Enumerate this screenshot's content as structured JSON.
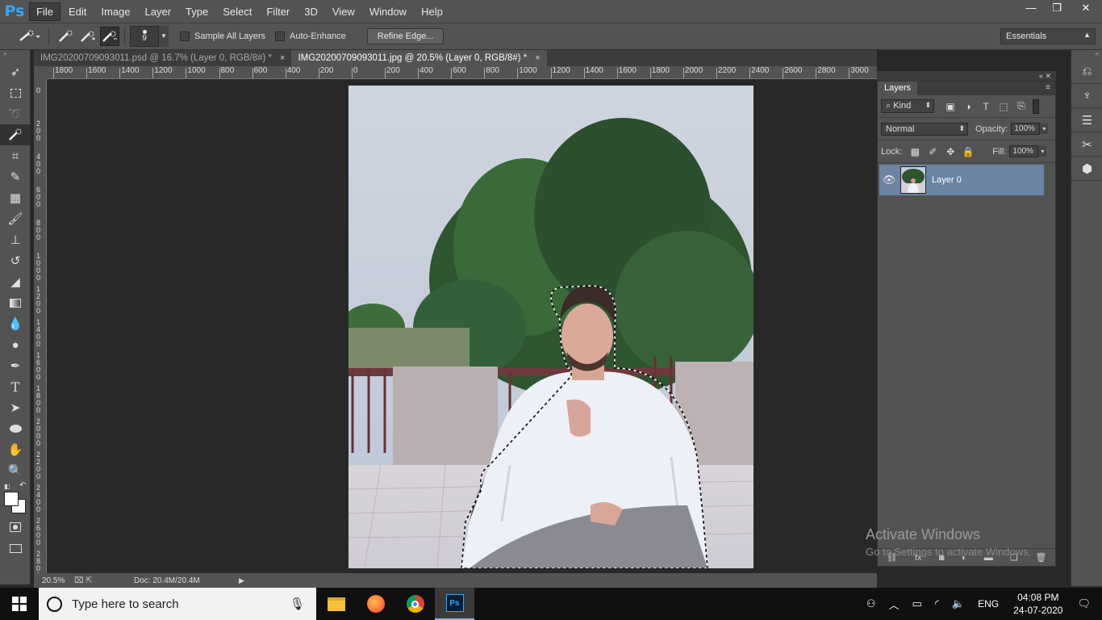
{
  "app": {
    "logo": "Ps"
  },
  "menu": [
    "File",
    "Edit",
    "Image",
    "Layer",
    "Type",
    "Select",
    "Filter",
    "3D",
    "View",
    "Window",
    "Help"
  ],
  "window_controls": {
    "minimize": "—",
    "restore": "❐",
    "close": "✕"
  },
  "options": {
    "brush_size": "9",
    "sample_all_layers": "Sample All Layers",
    "auto_enhance": "Auto-Enhance",
    "refine_edge": "Refine Edge...",
    "workspace": "Essentials"
  },
  "tabs": [
    {
      "label": "IMG20200709093011.psd @ 16.7% (Layer 0, RGB/8#) *",
      "close": "×"
    },
    {
      "label": "IMG20200709093011.jpg @ 20.5% (Layer 0, RGB/8#) *",
      "close": "×"
    }
  ],
  "ruler": {
    "h_ticks": [
      "1800",
      "1600",
      "1400",
      "1200",
      "1000",
      "800",
      "600",
      "400",
      "200",
      "0",
      "200",
      "400",
      "600",
      "800",
      "1000",
      "1200",
      "1400",
      "1600",
      "1800",
      "2000",
      "2200",
      "2400",
      "2600",
      "2800",
      "3000"
    ],
    "v_ticks": [
      "0",
      "2\n0\n0",
      "4\n0\n0",
      "6\n0\n0",
      "8\n0\n0",
      "1\n0\n0\n0",
      "1\n2\n0\n0",
      "1\n4\n0\n0",
      "1\n6\n0\n0",
      "1\n8\n0\n0",
      "2\n0\n0\n0",
      "2\n2\n0\n0",
      "2\n4\n0\n0",
      "2\n6\n0\n0",
      "2\n8\n0\n0"
    ]
  },
  "status": {
    "zoom": "20.5%",
    "doc": "Doc: 20.4M/20.4M"
  },
  "layers_panel": {
    "title": "Layers",
    "filter_kind": "Kind",
    "blend_mode": "Normal",
    "opacity_label": "Opacity:",
    "opacity_value": "100%",
    "lock_label": "Lock:",
    "fill_label": "Fill:",
    "fill_value": "100%",
    "layers": [
      {
        "name": "Layer 0",
        "visible": true,
        "selected": true
      }
    ]
  },
  "watermark": {
    "line1": "Activate Windows",
    "line2": "Go to Settings to activate Windows."
  },
  "taskbar": {
    "search_placeholder": "Type here to search",
    "language": "ENG",
    "time": "04:08 PM",
    "date": "24-07-2020"
  }
}
